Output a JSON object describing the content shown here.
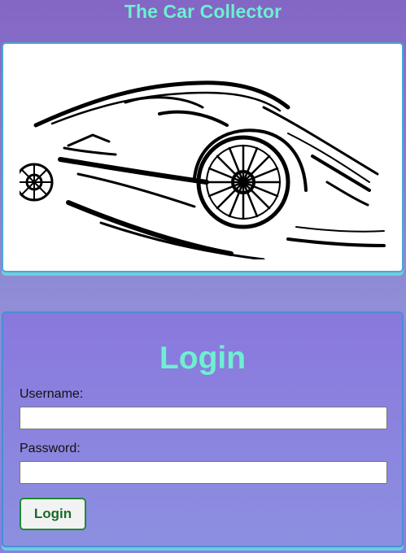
{
  "header": {
    "title": "The Car Collector"
  },
  "hero": {
    "image_subject": "sports-car-line-art"
  },
  "login": {
    "heading": "Login",
    "username_label": "Username:",
    "username_value": "",
    "password_label": "Password:",
    "password_value": "",
    "submit_label": "Login"
  },
  "colors": {
    "accent_text": "#6df0d0",
    "card_border": "#4a8ed6",
    "button_border": "#1f8a33"
  }
}
